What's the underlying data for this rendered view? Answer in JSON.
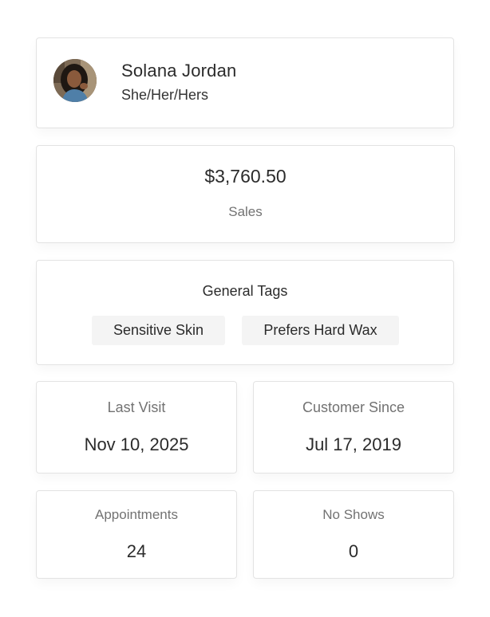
{
  "profile": {
    "name": "Solana Jordan",
    "pronouns": "She/Her/Hers"
  },
  "sales": {
    "amount": "$3,760.50",
    "label": "Sales"
  },
  "tags": {
    "title": "General Tags",
    "items": [
      "Sensitive Skin",
      "Prefers Hard Wax"
    ]
  },
  "stats": [
    {
      "label": "Last Visit",
      "value": "Nov 10, 2025"
    },
    {
      "label": "Customer Since",
      "value": "Jul 17, 2019"
    },
    {
      "label": "Appointments",
      "value": "24"
    },
    {
      "label": "No Shows",
      "value": "0"
    }
  ],
  "colors": {
    "text": "#2b2b2b",
    "muted": "#727272",
    "border": "#e3e3e3",
    "tag_bg": "#f4f4f4"
  }
}
